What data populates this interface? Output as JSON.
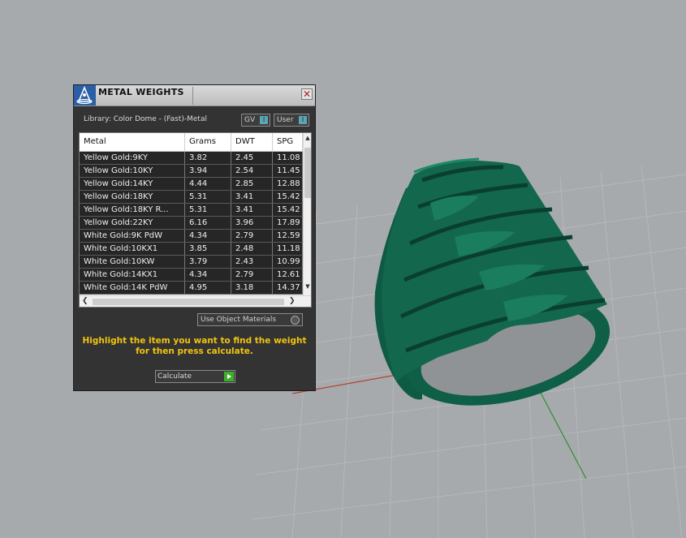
{
  "panel": {
    "title": "METAL WEIGHTS",
    "library_label": "Library: Color Dome - (Fast)-Metal",
    "toggles": [
      {
        "label": "GV",
        "state": "I"
      },
      {
        "label": "User",
        "state": "I"
      }
    ],
    "table": {
      "headers": [
        "Metal",
        "Grams",
        "DWT",
        "SPG"
      ],
      "rows": [
        [
          "Yellow Gold:9KY",
          "3.82",
          "2.45",
          "11.08"
        ],
        [
          "Yellow Gold:10KY",
          "3.94",
          "2.54",
          "11.45"
        ],
        [
          "Yellow Gold:14KY",
          "4.44",
          "2.85",
          "12.88"
        ],
        [
          "Yellow Gold:18KY",
          "5.31",
          "3.41",
          "15.42"
        ],
        [
          "Yellow Gold:18KY R...",
          "5.31",
          "3.41",
          "15.42"
        ],
        [
          "Yellow Gold:22KY",
          "6.16",
          "3.96",
          "17.89"
        ],
        [
          "White Gold:9K PdW",
          "4.34",
          "2.79",
          "12.59"
        ],
        [
          "White Gold:10KX1",
          "3.85",
          "2.48",
          "11.18"
        ],
        [
          "White Gold:10KW",
          "3.79",
          "2.43",
          "10.99"
        ],
        [
          "White Gold:14KX1",
          "4.34",
          "2.79",
          "12.61"
        ],
        [
          "White Gold:14K PdW",
          "4.95",
          "3.18",
          "14.37"
        ]
      ]
    },
    "use_object_materials_label": "Use Object Materials",
    "instruction": "Highlight the item you want to find the weight for then press calculate.",
    "calculate_label": "Calculate"
  },
  "colors": {
    "viewport_background": "#a6aaad",
    "model_green": "#13674d",
    "instruction_text": "#f1c40f",
    "panel_background": "#333333"
  },
  "icons": [
    "dome-logo-icon",
    "close-icon",
    "scroll-up-icon",
    "scroll-down-icon",
    "scroll-left-icon",
    "scroll-right-icon",
    "play-arrow-icon"
  ]
}
